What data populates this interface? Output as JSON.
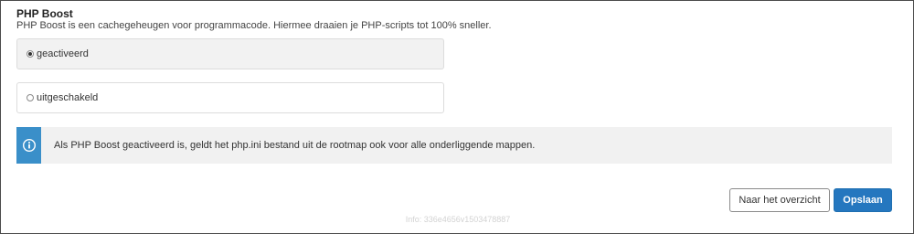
{
  "section": {
    "title": "PHP Boost",
    "description": "PHP Boost is een cachegeheugen voor programmacode. Hiermee draaien je PHP-scripts tot 100% sneller."
  },
  "options": [
    {
      "label": "geactiveerd",
      "checked": true
    },
    {
      "label": "uitgeschakeld",
      "checked": false
    }
  ],
  "info": {
    "icon": "info-icon",
    "text": "Als PHP Boost geactiveerd is, geldt het php.ini bestand uit de rootmap ook voor alle onderliggende mappen."
  },
  "buttons": {
    "back_label": "Naar het overzicht",
    "save_label": "Opslaan"
  },
  "footer": {
    "info": "Info: 336e4656v1503478887"
  },
  "colors": {
    "accent": "#2577bf",
    "info_bar": "#3a8fc9"
  }
}
